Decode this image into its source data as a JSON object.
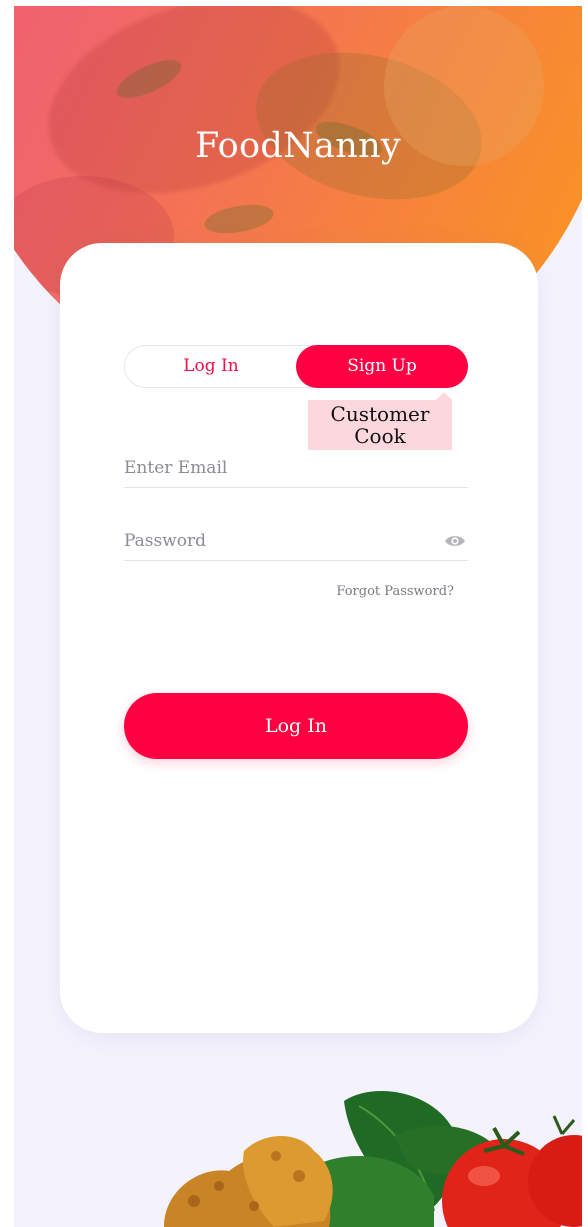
{
  "app": {
    "title": "FoodNanny"
  },
  "auth_tabs": {
    "login_label": "Log In",
    "signup_label": "Sign Up"
  },
  "role_dropdown": {
    "options": [
      "Customer",
      "Cook"
    ]
  },
  "form": {
    "email_placeholder": "Enter Email",
    "password_placeholder": "Password",
    "forgot_label": "Forgot Password?",
    "submit_label": "Log In"
  },
  "icons": {
    "password_toggle": "eye-icon"
  },
  "colors": {
    "accent": "#ff0043",
    "hero_start": "#ec5a78",
    "hero_end": "#fb9a1c",
    "background": "#f4f3fd"
  }
}
